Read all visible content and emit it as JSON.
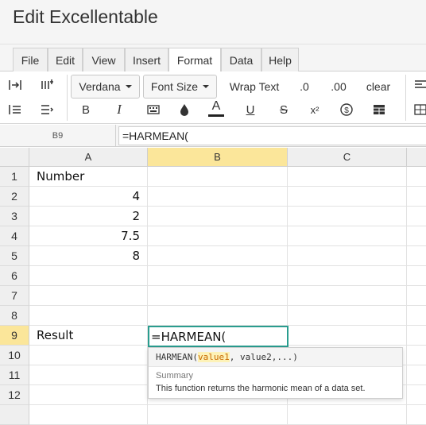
{
  "app": {
    "title": "Edit Excellentable"
  },
  "menu_tabs": [
    "File",
    "Edit",
    "View",
    "Insert",
    "Format",
    "Data",
    "Help"
  ],
  "active_tab": "Format",
  "toolbar": {
    "font_family": "Verdana",
    "font_size": "Font Size",
    "wrap_text": "Wrap Text",
    "decimal_decrease": ".0",
    "decimal_increase": ".00",
    "clear": "clear",
    "bold": "B",
    "italic": "I",
    "underline": "U",
    "strike": "S",
    "font_color_glyph": "A",
    "superscript": "x²",
    "currency": "$"
  },
  "formula_bar": {
    "cell_ref": "B9",
    "formula": "=HARMEAN("
  },
  "columns": [
    "A",
    "B",
    "C"
  ],
  "selected_column": "B",
  "rows": [
    "1",
    "2",
    "3",
    "4",
    "5",
    "6",
    "7",
    "8",
    "9",
    "10",
    "11",
    "12"
  ],
  "selected_row": "9",
  "cells": {
    "A1": "Number",
    "A2": "4",
    "A3": "2",
    "A4": "7.5",
    "A5": "8",
    "A9": "Result",
    "B9": "=HARMEAN("
  },
  "autocomplete": {
    "fn_name": "HARMEAN(",
    "arg_highlight": "value1",
    "arg_rest": ", value2,...)",
    "summary_label": "Summary",
    "description": "This function returns the harmonic mean of a data set."
  },
  "colors": {
    "selected_header": "#fbe69a",
    "active_cell_border": "#2a9d8f",
    "font_color_underline": "#222222"
  }
}
